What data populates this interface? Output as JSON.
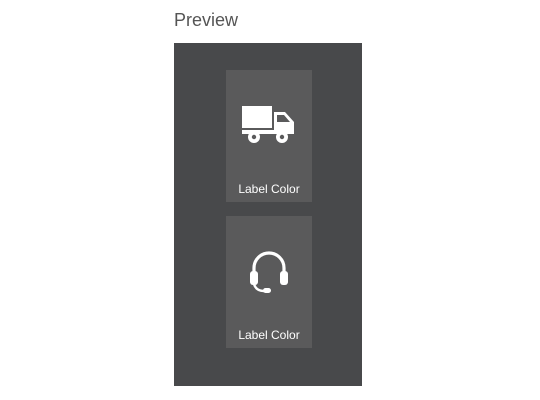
{
  "section": {
    "title": "Preview"
  },
  "preview": {
    "background": "#48494b",
    "tile_background": "#5a5a5b",
    "tiles": [
      {
        "icon": "truck-icon",
        "label": "Label Color"
      },
      {
        "icon": "headset-icon",
        "label": "Label Color"
      }
    ]
  }
}
